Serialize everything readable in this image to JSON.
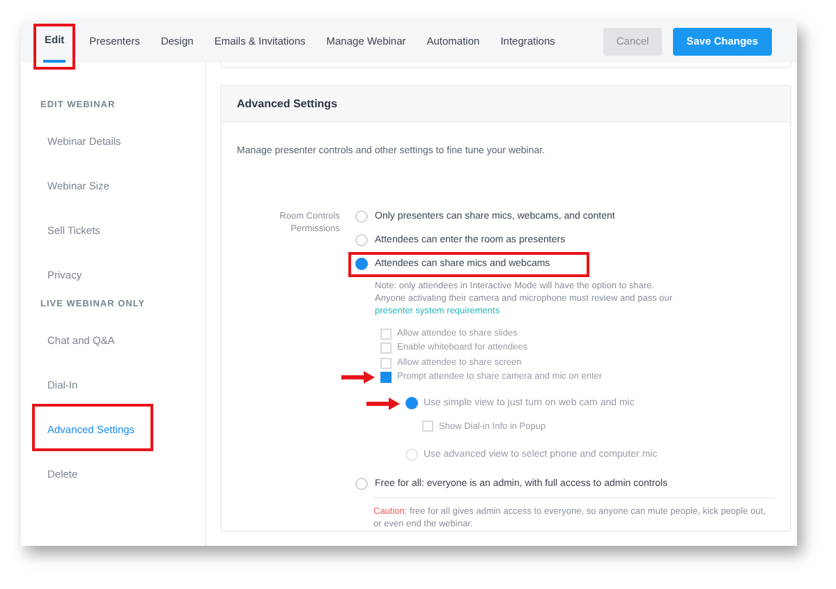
{
  "tabs": [
    {
      "label": "Edit",
      "selected": true,
      "highlighted": true
    },
    {
      "label": "Presenters",
      "selected": false,
      "highlighted": false
    },
    {
      "label": "Design",
      "selected": false,
      "highlighted": false
    },
    {
      "label": "Emails & Invitations",
      "selected": false,
      "highlighted": false
    },
    {
      "label": "Manage Webinar",
      "selected": false,
      "highlighted": false
    },
    {
      "label": "Automation",
      "selected": false,
      "highlighted": false
    },
    {
      "label": "Integrations",
      "selected": false,
      "highlighted": false
    }
  ],
  "buttons": [
    {
      "label": "Cancel",
      "kind": "secondary"
    },
    {
      "label": "Save Changes",
      "kind": "primary"
    }
  ],
  "sidebar": [
    {
      "heading": "EDIT WEBINAR",
      "items": [
        {
          "label": "Webinar Details",
          "selected": false,
          "highlighted": false
        },
        {
          "label": "Webinar Size",
          "selected": false,
          "highlighted": false
        },
        {
          "label": "Sell Tickets",
          "selected": false,
          "highlighted": false
        },
        {
          "label": "Privacy",
          "selected": false,
          "highlighted": false
        }
      ]
    },
    {
      "heading": "LIVE WEBINAR ONLY",
      "items": [
        {
          "label": "Chat and Q&A",
          "selected": false,
          "highlighted": false
        },
        {
          "label": "Dial-In",
          "selected": false,
          "highlighted": false
        },
        {
          "label": "Advanced Settings",
          "selected": true,
          "highlighted": true
        },
        {
          "label": "Delete",
          "selected": false,
          "highlighted": false
        }
      ]
    }
  ],
  "panel": {
    "title": "Advanced Settings",
    "description": "Manage presenter controls and other settings to fine tune your webinar.",
    "field_label": "Room Controls Permissions",
    "options": [
      {
        "label": "Only presenters can share mics, webcams, and content",
        "selected": false,
        "highlighted": false
      },
      {
        "label": "Attendees can enter the room as presenters",
        "selected": false,
        "highlighted": false
      },
      {
        "label": "Attendees can share mics and webcams",
        "selected": true,
        "highlighted": true,
        "note": {
          "line_1": "Note: only attendees in Interactive Mode will have the option to share.",
          "line_2": "Anyone activating their camera and microphone must review and pass our",
          "link": "presenter system requirements"
        },
        "checkboxes": [
          {
            "label": "Allow attendee to share slides",
            "checked": false,
            "arrow": false
          },
          {
            "label": "Enable whiteboard for attendees",
            "checked": false,
            "arrow": false
          },
          {
            "label": "Allow attendee to share screen",
            "checked": false,
            "arrow": false
          },
          {
            "label": "Prompt attendee to share camera and mic on enter",
            "checked": true,
            "arrow": true
          }
        ],
        "views": [
          {
            "label": "Use simple view to just turn on web cam and mic",
            "selected": true,
            "arrow": true,
            "checkboxes": [
              {
                "label": "Show Dial-in Info in Popup",
                "checked": false
              }
            ]
          },
          {
            "label": "Use advanced view to select phone and computer mic",
            "selected": false,
            "arrow": false
          }
        ]
      },
      {
        "label": "Free for all: everyone is an admin, with full access to admin controls",
        "selected": false,
        "highlighted": false,
        "caution": {
          "label": "Caution:",
          "text": "free for all gives admin access to everyone, so anyone can mute people, kick people out, or even end the webinar."
        }
      }
    ]
  }
}
